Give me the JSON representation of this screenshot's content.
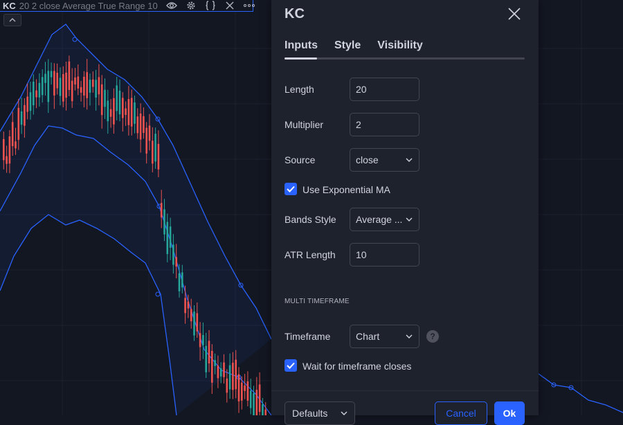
{
  "legend": {
    "title": "KC",
    "params": "20 2 close Average True Range 10",
    "icons": [
      "eye-icon",
      "gear-icon",
      "braces-icon",
      "close-icon",
      "more-icon"
    ]
  },
  "dialog": {
    "title": "KC",
    "tabs": [
      "Inputs",
      "Style",
      "Visibility"
    ],
    "active_tab": "Inputs",
    "fields": {
      "length": {
        "label": "Length",
        "value": "20"
      },
      "multiplier": {
        "label": "Multiplier",
        "value": "2"
      },
      "source": {
        "label": "Source",
        "value": "close"
      },
      "use_ema": {
        "label": "Use Exponential MA",
        "checked": true
      },
      "bands_style": {
        "label": "Bands Style",
        "value": "Average ..."
      },
      "atr_length": {
        "label": "ATR Length",
        "value": "10"
      }
    },
    "section_title": "MULTI TIMEFRAME",
    "timeframe": {
      "label": "Timeframe",
      "value": "Chart",
      "help": "?"
    },
    "wait_close": {
      "label": "Wait for timeframe closes",
      "checked": true
    },
    "buttons": {
      "defaults": "Defaults",
      "cancel": "Cancel",
      "ok": "Ok"
    }
  },
  "colors": {
    "background": "#131722",
    "dialog": "#1e222d",
    "accent": "#2962ff",
    "band": "#2962ff",
    "up_candle": "#26a69a",
    "down_candle": "#ef5350"
  }
}
